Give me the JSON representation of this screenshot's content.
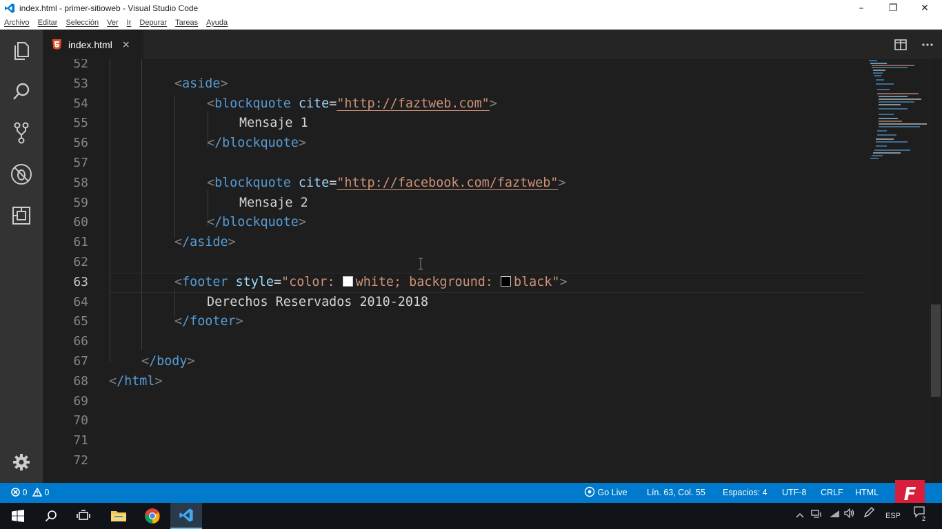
{
  "window": {
    "title": "index.html - primer-sitioweb - Visual Studio Code",
    "controls": {
      "minimize": "–",
      "restore": "❐",
      "close": "✕"
    }
  },
  "menu": [
    "Archivo",
    "Editar",
    "Selección",
    "Ver",
    "Ir",
    "Depurar",
    "Tareas",
    "Ayuda"
  ],
  "activity_bar": [
    "explorer-icon",
    "search-icon",
    "source-control-icon",
    "debug-icon",
    "extensions-icon",
    "settings-gear-icon"
  ],
  "tab": {
    "label": "index.html",
    "close": "×",
    "icon": "html5-icon"
  },
  "editor": {
    "line_numbers": [
      "52",
      "53",
      "54",
      "55",
      "56",
      "57",
      "58",
      "59",
      "60",
      "61",
      "62",
      "63",
      "64",
      "65",
      "66",
      "67",
      "68",
      "69",
      "70",
      "71",
      "72"
    ],
    "current_line": "63",
    "tokens": {
      "aside_open": "aside",
      "aside_close": "/aside",
      "blockquote": "blockquote",
      "blockquote_close": "/blockquote",
      "cite_attr": "cite",
      "cite_1": "\"http://faztweb.com\"",
      "cite_2": "\"http://facebook.com/faztweb\"",
      "mensaje_1": "Mensaje 1",
      "mensaje_2": "Mensaje 2",
      "footer": "footer",
      "footer_close": "/footer",
      "style_attr": "style",
      "style_open_quote": "\"color: ",
      "style_white": "white; background: ",
      "style_black": "black\"",
      "footer_text": "Derechos Reservados 2010-2018",
      "body_close": "/body",
      "html_close": "/html"
    },
    "colors": {
      "tag": "#569cd6",
      "attribute": "#9cdcfe",
      "string": "#ce9178",
      "text": "#d4d4d4",
      "bracket": "#808080",
      "white_swatch": "#ffffff",
      "black_swatch": "#000000"
    }
  },
  "statusbar": {
    "errors": "0",
    "warnings": "0",
    "go_live": "Go Live",
    "position": "Lín. 63, Col. 55",
    "spaces": "Espacios: 4",
    "encoding": "UTF-8",
    "eol": "CRLF",
    "language": "HTML",
    "logo": "F"
  },
  "taskbar": {
    "apps": [
      "windows-start-icon",
      "search-icon",
      "task-view-icon",
      "file-explorer-icon",
      "chrome-icon",
      "vscode-icon"
    ],
    "language": "ESP",
    "notifications": "2"
  }
}
